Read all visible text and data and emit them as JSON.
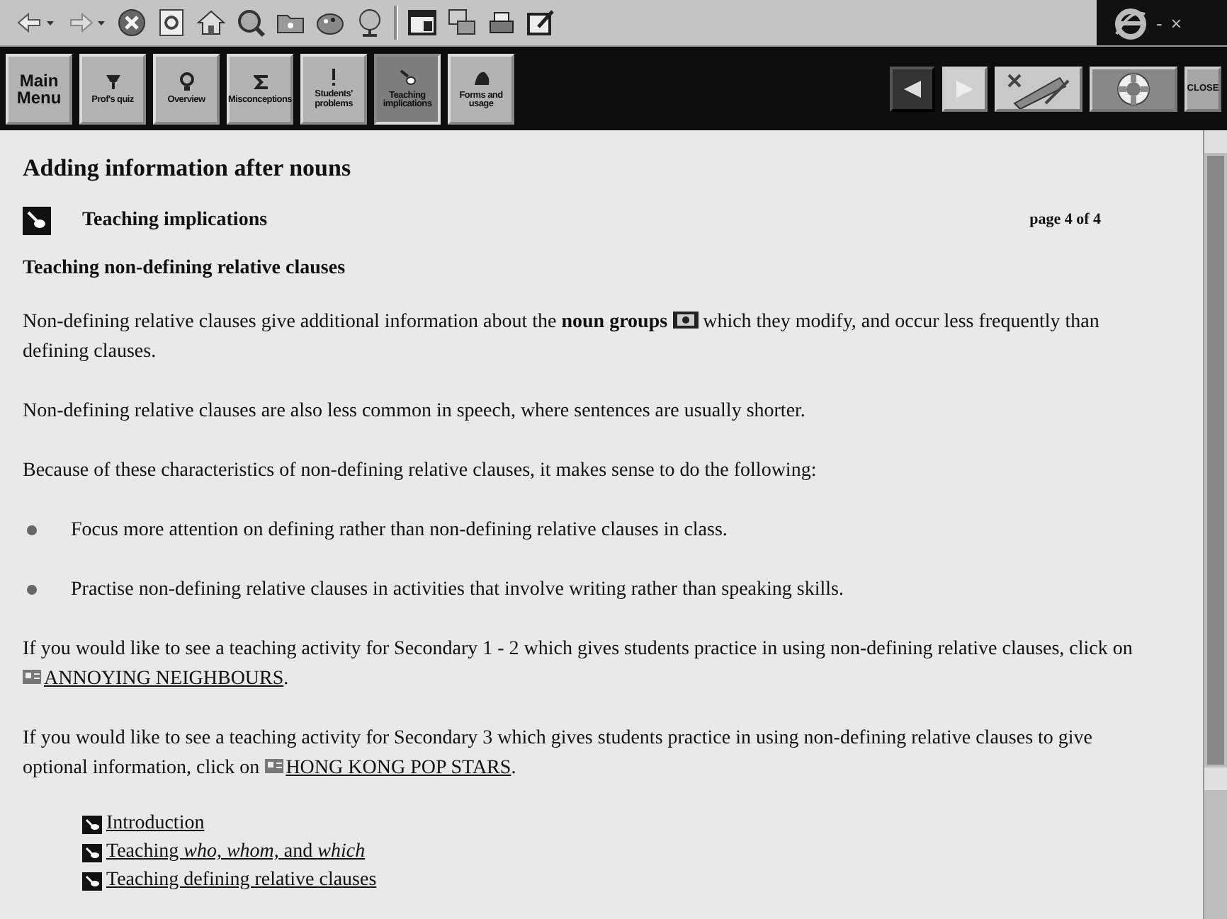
{
  "window_controls": [
    "-",
    "×"
  ],
  "nav_buttons": [
    {
      "label": "Main Menu",
      "kind": "menu",
      "selected": false
    },
    {
      "label": "Prof's quiz",
      "kind": "quiz",
      "selected": false
    },
    {
      "label": "Overview",
      "kind": "overview",
      "selected": false
    },
    {
      "label": "Misconceptions",
      "kind": "misconceptions",
      "selected": false
    },
    {
      "label": "Students' problems",
      "kind": "problems",
      "selected": false
    },
    {
      "label": "Teaching implications",
      "kind": "teaching",
      "selected": true
    },
    {
      "label": "Forms and usage",
      "kind": "forms",
      "selected": false
    }
  ],
  "close_button": "CLOSE",
  "content": {
    "title": "Adding information after nouns",
    "section": {
      "label": "Teaching implications",
      "page": "page 4 of 4"
    },
    "heading": "Teaching non-defining relative clauses",
    "blocks": [
      {
        "kind": "glossary",
        "text": "Non-defining relative clauses give additional information about the **noun groups**",
        "after": "which they modify, and occur less frequently than defining clauses."
      },
      {
        "kind": "paragraph",
        "text": "Non-defining relative clauses are also less common in speech, where sentences are usually shorter."
      },
      {
        "kind": "paragraph",
        "text": "Because of these characteristics of non-defining relative clauses, it makes sense to do the following:"
      },
      {
        "kind": "bullet",
        "text": "Focus more attention on defining rather than non-defining relative clauses in class."
      },
      {
        "kind": "bullet",
        "text": "Practise non-defining relative clauses in activities that involve writing rather than speaking skills."
      },
      {
        "kind": "activity",
        "text": "If you would like to see a teaching activity for Secondary 1 - 2 which gives students practice in using non-defining relative clauses, click on",
        "link": "ANNOYING NEIGHBOURS",
        "after": "."
      },
      {
        "kind": "activity",
        "text": "If you would like to see a teaching activity for Secondary 3 which gives students practice in using non-defining relative clauses to give optional information, click on",
        "link": "HONG KONG POP STARS",
        "after": "."
      }
    ],
    "links": [
      "Introduction",
      "Teaching *who, whom,* and *which*",
      "Teaching defining relative clauses"
    ]
  }
}
